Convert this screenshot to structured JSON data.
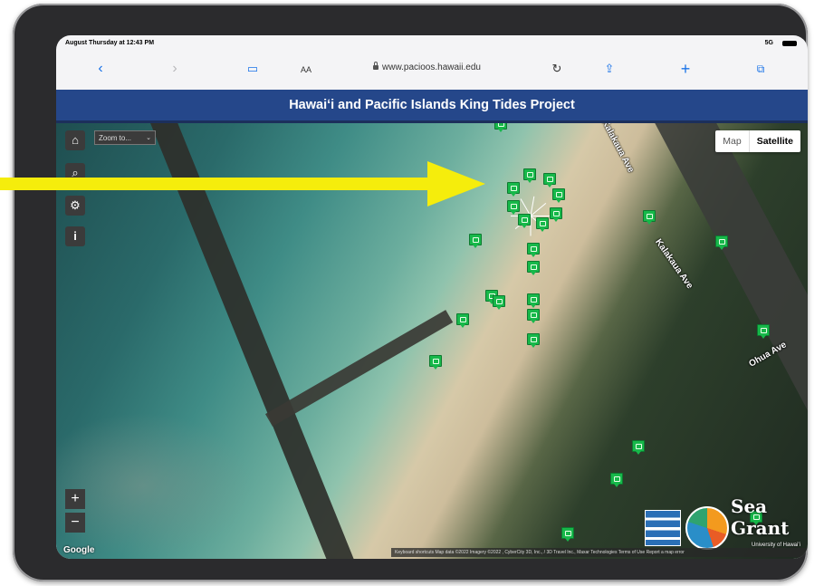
{
  "status_bar": {
    "time": "August Thursday at 12:43 PM",
    "signal": "5G"
  },
  "browser": {
    "aa": "AA",
    "url": "www.pacioos.hawaii.edu",
    "icons": [
      "back-icon",
      "forward-icon",
      "book-icon",
      "reload-icon",
      "share-icon",
      "plus-icon",
      "tabs-icon"
    ]
  },
  "page": {
    "title": "Hawaiʻi and Pacific Islands King Tides Project"
  },
  "map": {
    "zoom_select": "Zoom to...",
    "map_type": {
      "map": "Map",
      "satellite": "Satellite",
      "selected": "Satellite"
    },
    "streets": [
      "Kalakaua Ave",
      "Kalakaua Ave",
      "Ohua Ave"
    ],
    "google": "Google",
    "attribution": "Keyboard shortcuts   Map data ©2022 Imagery ©2022 , CyberCity 3D, Inc., / 3D Travel Inc., Maxar Technologies   Terms of Use   Report a map error",
    "zoom_in": "+",
    "zoom_out": "−",
    "logos": {
      "sea_grant": "Sea Grant",
      "sea_grant_sub": "University of Hawaiʻi"
    }
  },
  "colors": {
    "header": "#25478a",
    "marker": "#17b84a",
    "arrow": "#f5ed0c",
    "link": "#1a73e8"
  }
}
